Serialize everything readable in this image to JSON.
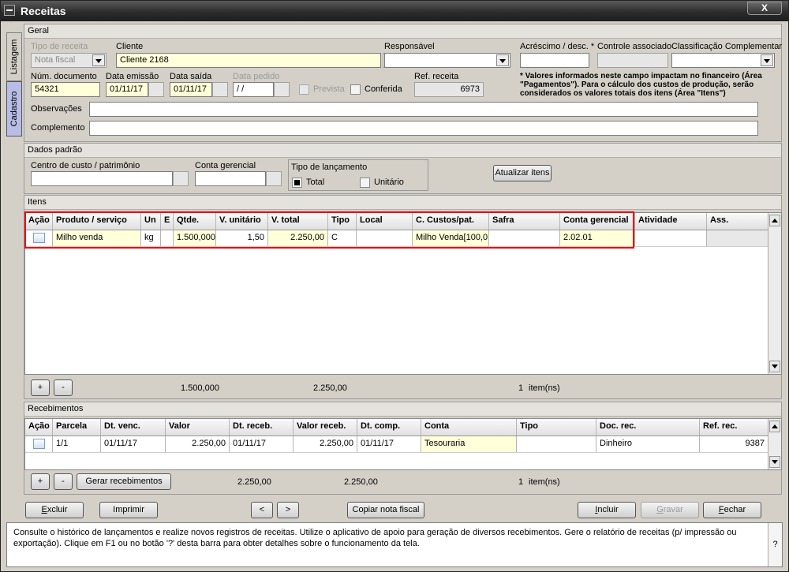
{
  "window": {
    "title": "Receitas",
    "close": "X"
  },
  "sidetabs": {
    "listagem": "Listagem",
    "cadastro": "Cadastro"
  },
  "geral": {
    "header": "Geral",
    "tipo_receita_label": "Tipo de receita",
    "tipo_receita_value": "Nota fiscal",
    "cliente_label": "Cliente",
    "cliente_value": "Cliente 2168",
    "responsavel_label": "Responsável",
    "acrescimo_label": "Acréscimo / desc. *",
    "controle_label": "Controle associado",
    "classificacao_label": "Classificação Complementar",
    "num_doc_label": "Núm. documento",
    "num_doc_value": "54321",
    "data_emissao_label": "Data emissão",
    "data_emissao_value": "01/11/17",
    "data_saida_label": "Data saída",
    "data_saida_value": "01/11/17",
    "data_pedido_label": "Data pedido",
    "data_pedido_value": " / /",
    "prevista_label": "Prevista",
    "conferida_label": "Conferida",
    "ref_receita_label": "Ref. receita",
    "ref_receita_value": "6973",
    "note": "* Valores informados neste campo impactam no financeiro (Área \"Pagamentos\"). Para o cálculo dos custos de produção, serão considerados os valores totais dos itens (Área \"Itens\")",
    "observacoes_label": "Observações",
    "complemento_label": "Complemento"
  },
  "dados": {
    "header": "Dados padrão",
    "centro_label": "Centro de custo / patrimônio",
    "conta_label": "Conta gerencial",
    "tipo_lanc_label": "Tipo de lançamento",
    "total_label": "Total",
    "unitario_label": "Unitário",
    "atualizar": "Atualizar itens"
  },
  "itens": {
    "header": "Itens",
    "columns": [
      "Ação",
      "Produto / serviço",
      "Un",
      "E",
      "Qtde.",
      "V. unitário",
      "V. total",
      "Tipo",
      "Local",
      "C. Custos/pat.",
      "Safra",
      "Conta gerencial",
      "Atividade",
      "Ass."
    ],
    "row": {
      "produto": "Milho venda",
      "un": "kg",
      "e": "",
      "qtde": "1.500,000",
      "v_unit": "1,50",
      "v_total": "2.250,00",
      "tipo": "C",
      "local": "",
      "ccustos": "Milho  Venda[100,0",
      "safra": "",
      "conta": "2.02.01",
      "atividade": "",
      "ass": ""
    },
    "add": "+",
    "remove": "-",
    "total_qtde": "1.500,000",
    "total_valor": "2.250,00",
    "count": "1",
    "count_label": "item(ns)",
    "highlight_color": "#e8000a"
  },
  "recebimentos": {
    "header": "Recebimentos",
    "columns": [
      "Ação",
      "Parcela",
      "Dt. venc.",
      "Valor",
      "Dt. receb.",
      "Valor receb.",
      "Dt. comp.",
      "Conta",
      "Tipo",
      "Doc. rec.",
      "Ref. rec."
    ],
    "row": {
      "parcela": "1/1",
      "dt_venc": "01/11/17",
      "valor": "2.250,00",
      "dt_receb": "01/11/17",
      "valor_receb": "2.250,00",
      "dt_comp": "01/11/17",
      "conta": "Tesouraria",
      "tipo": "",
      "doc_rec": "Dinheiro",
      "ref_rec": "9387"
    },
    "add": "+",
    "remove": "-",
    "gerar": "Gerar recebimentos",
    "total_valor": "2.250,00",
    "total_receb": "2.250,00",
    "count": "1",
    "count_label": "item(ns)"
  },
  "footer": {
    "excluir": "xcluir",
    "excluir_u": "E",
    "imprimir": "Imprimir",
    "prev": "<",
    "next": ">",
    "copiar": "Copiar nota fiscal",
    "incluir": "ncluir",
    "incluir_u": "I",
    "gravar": "ravar",
    "gravar_u": "G",
    "fechar": "echar",
    "fechar_u": "F"
  },
  "help": {
    "text": "Consulte o histórico de lançamentos e realize novos registros de receitas. Utilize o aplicativo de apoio para geração de diversos recebimentos. Gere o relatório de receitas (p/ impressão ou exportação). Clique em F1 ou no botão '?' desta barra para obter detalhes sobre o funcionamento da tela.",
    "q": "?"
  }
}
